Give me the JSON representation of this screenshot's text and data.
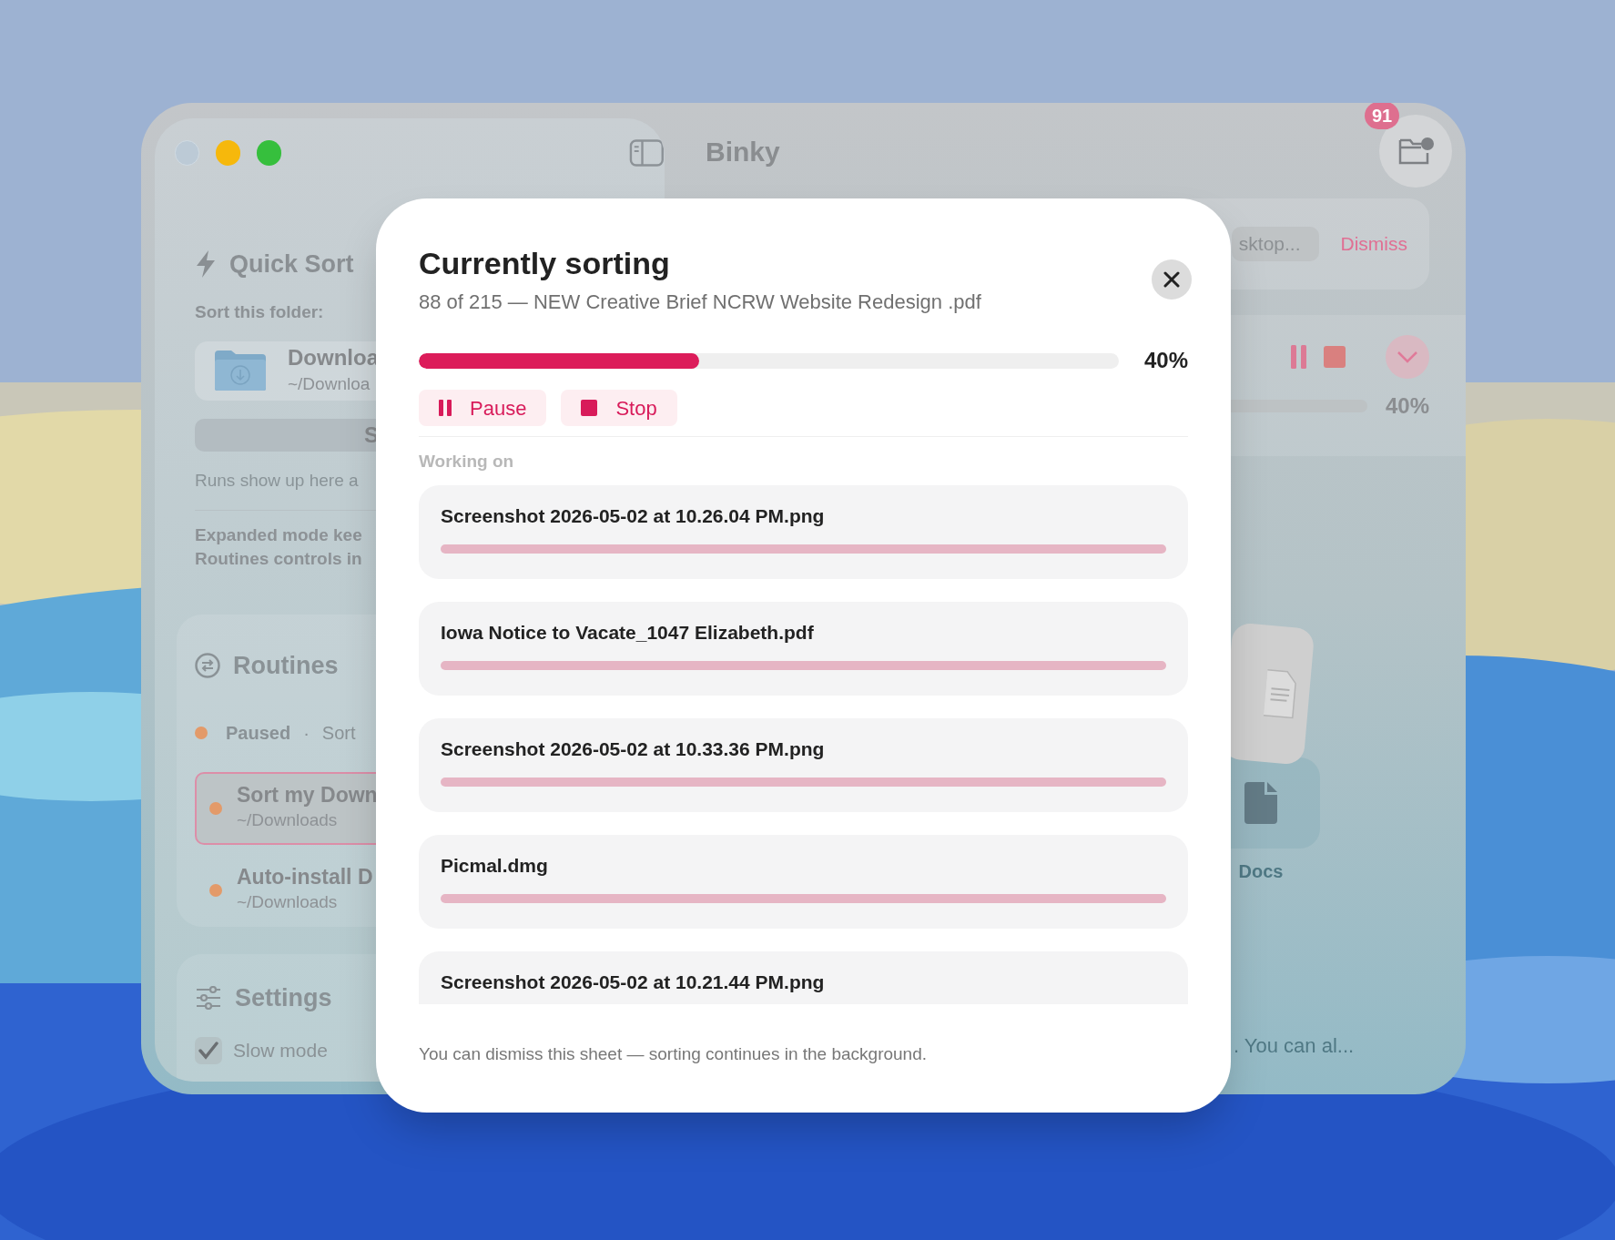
{
  "window": {
    "title": "Binky"
  },
  "inbox_button": {
    "badge": "91"
  },
  "sidebar": {
    "quick_sort": {
      "title": "Quick Sort",
      "folder_label": "Sort this folder:",
      "folder": {
        "name": "Downloa",
        "path": "~/Downloa"
      },
      "sort_button": "S",
      "hint": "Runs show up here a",
      "note": [
        "Expanded mode kee",
        "Routines controls in"
      ]
    },
    "routines": {
      "title": "Routines",
      "status": {
        "label": "Paused",
        "separator": "·",
        "detail": "Sort"
      },
      "items": [
        {
          "name": "Sort my Down",
          "path": "~/Downloads",
          "selected": true
        },
        {
          "name": "Auto-install D",
          "path": "~/Downloads",
          "selected": false
        }
      ]
    },
    "settings": {
      "title": "Settings",
      "options": [
        {
          "label": "Slow mode",
          "checked": true
        }
      ]
    }
  },
  "main": {
    "notice": {
      "button": "sktop...",
      "dismiss": "Dismiss"
    },
    "run": {
      "percent": "40%"
    },
    "destinations": [
      {
        "label": "Docs"
      }
    ],
    "footer": ". You can al..."
  },
  "sheet": {
    "title": "Currently sorting",
    "subtitle": "88 of 215 — NEW Creative Brief NCRW Website Redesign .pdf",
    "progress": {
      "level": 0.4,
      "percent": "40%"
    },
    "buttons": [
      {
        "kind": "pause",
        "label": "Pause"
      },
      {
        "kind": "stop",
        "label": "Stop"
      }
    ],
    "section_label": "Working on",
    "items": [
      {
        "name": "Screenshot 2026-05-02 at 10.26.04 PM.png",
        "active": true
      },
      {
        "name": "Iowa Notice to Vacate_1047 Elizabeth.pdf",
        "active": true
      },
      {
        "name": "Screenshot 2026-05-02 at 10.33.36 PM.png",
        "active": true
      },
      {
        "name": "Picmal.dmg",
        "active": true
      },
      {
        "name": "Screenshot 2026-05-02 at 10.21.44 PM.png"
      }
    ],
    "footer": "You can dismiss this sheet — sorting continues in the background."
  }
}
